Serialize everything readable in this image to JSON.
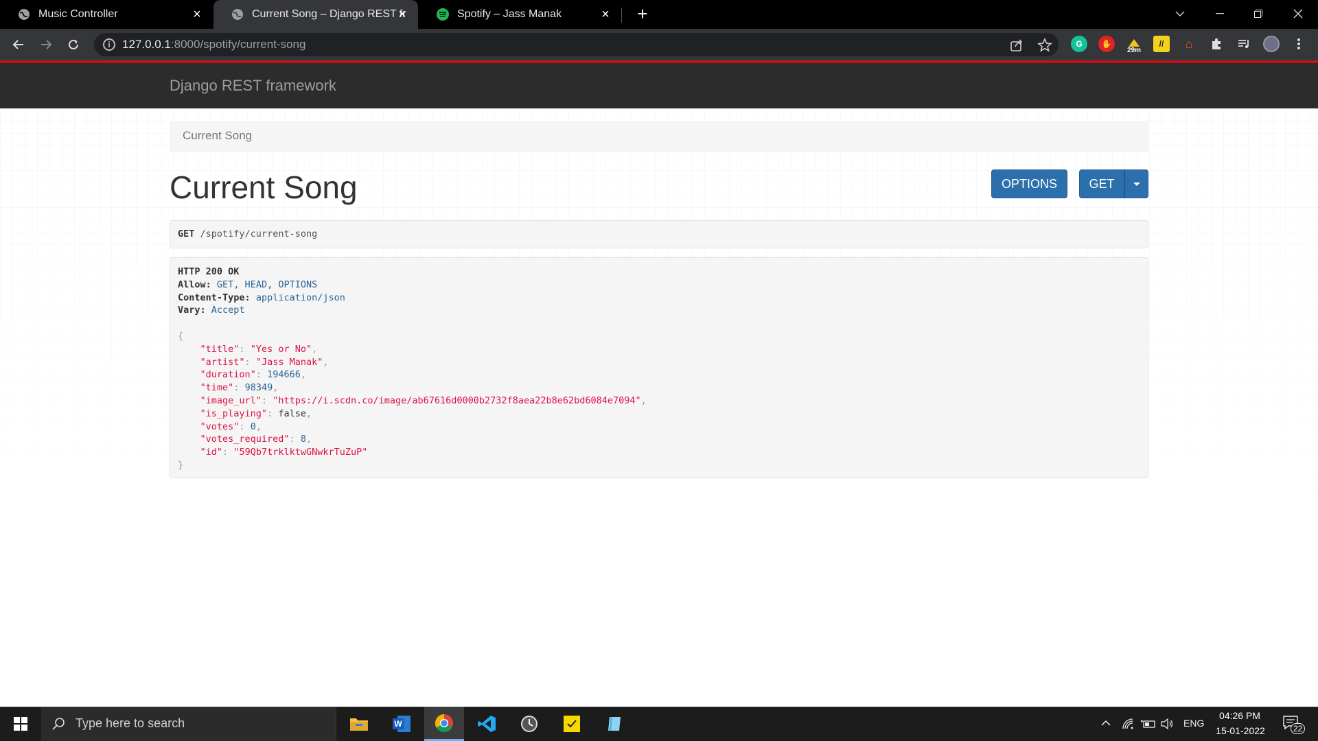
{
  "browser": {
    "tabs": [
      {
        "title": "Music Controller",
        "icon": "globe-icon",
        "active": false
      },
      {
        "title": "Current Song – Django REST fram",
        "icon": "globe-icon",
        "active": true
      },
      {
        "title": "Spotify – Jass Manak",
        "icon": "spotify-icon",
        "active": false
      }
    ],
    "url_host": "127.0.0.1",
    "url_path": ":8000/spotify/current-song",
    "extension_badge": "29m"
  },
  "drf": {
    "brand": "Django REST framework",
    "breadcrumb": "Current Song",
    "page_title": "Current Song",
    "options_label": "OPTIONS",
    "get_label": "GET",
    "request_method": "GET",
    "request_path": "/spotify/current-song",
    "response": {
      "status": "HTTP 200 OK",
      "allow_key": "Allow:",
      "allow_value": "GET, HEAD, OPTIONS",
      "content_type_key": "Content-Type:",
      "content_type_value": "application/json",
      "vary_key": "Vary:",
      "vary_value": "Accept",
      "json": {
        "title": "Yes or No",
        "artist": "Jass Manak",
        "duration": "194666",
        "time": "98349",
        "image_url": "https://i.scdn.co/image/ab67616d0000b2732f8aea22b8e62bd6084e7094",
        "is_playing": "false",
        "votes": "0",
        "votes_required": "8",
        "id": "59Qb7trklktwGNwkrTuZuP"
      }
    }
  },
  "taskbar": {
    "search_placeholder": "Type here to search",
    "language": "ENG",
    "time": "04:26 PM",
    "date": "15-01-2022",
    "notifications": "22"
  },
  "colors": {
    "drf_navbar": "#2c2c2c",
    "button_primary": "#2c6fad",
    "loading_bar": "#c4121b"
  }
}
